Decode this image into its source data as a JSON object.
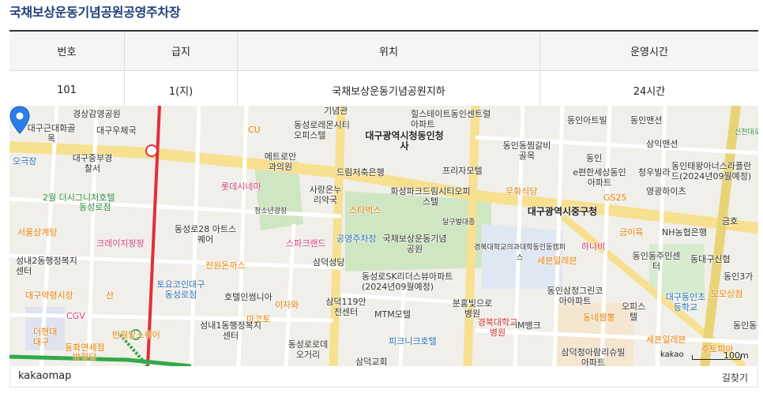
{
  "page_title": "국채보상운동기념공원공영주차장",
  "table": {
    "headers": [
      "번호",
      "급지",
      "위치",
      "운영시간"
    ],
    "row": [
      "101",
      "1(지)",
      "국채보상운동기념공원지하",
      "24시간"
    ]
  },
  "map": {
    "labels": [
      "경상감영공원",
      "대구우체국",
      "대구근대화골목",
      "대구중부경찰서",
      "오극장",
      "2월 더시그니처호텔",
      "동성로점",
      "서울삼계탕",
      "크레이지팡팡",
      "성내2동행정복지센터",
      "대구약령시장",
      "CGV",
      "더현대대구",
      "동화면세점",
      "반월당",
      "반월당스퀘어",
      "CU",
      "동성로레몬시티오피스텔",
      "메트로안과의원",
      "롯데시네마",
      "사랑온누리약국",
      "청소년광장",
      "동성로28 아트스퀘어",
      "스파크랜드",
      "전원돈까스",
      "토요코인대구동성로점",
      "호텔인썸니아",
      "이자와",
      "마코토",
      "성내1동행정복지센터",
      "동성로로데오거리",
      "산",
      "기념관",
      "힐스테이트동인센트럴아파트",
      "대구광역시청동인청사",
      "드림저축은행",
      "프리자모텔",
      "화성파크드림시티오피스텔",
      "스타벅스",
      "공영주차장",
      "국채보상운동기념공원",
      "달구벌대종",
      "삼덕성당",
      "동성로SK리더스뷰아파트(2024년09월예정)",
      "삼덕119안전센터",
      "MTM모텔",
      "피크니크호텔",
      "분홍빛으로병원",
      "경북대학교병원",
      "iM뱅크",
      "삼덕교회",
      "동인아트빌",
      "동인맨션",
      "동인동찜갈비골목",
      "무화식당",
      "대구광역시중구청",
      "경북대학교의과대학동인동캠퍼스",
      "세븐일레븐",
      "하나비",
      "동인삼정그린코아아파트",
      "동네짬뽕",
      "삼덕청아람리슈빌아파트",
      "세븐일레븐",
      "삼익맨션",
      "동인태왕아너스라플란드(2024년09월예정)",
      "청우빌라",
      "영광하이츠",
      "e편한세상동인아파트",
      "GS25",
      "금이육",
      "NH농협은행",
      "금호",
      "동대구신협",
      "동인3가",
      "대구동인초등학교",
      "오피스텔",
      "모모상점",
      "동인동",
      "주토피아",
      "신천대로",
      "동인",
      "동인동주민센터"
    ],
    "scale_text": "100m",
    "kakao_mark": "kakao",
    "brand": "kakaomap",
    "find_route": "길찾기"
  }
}
